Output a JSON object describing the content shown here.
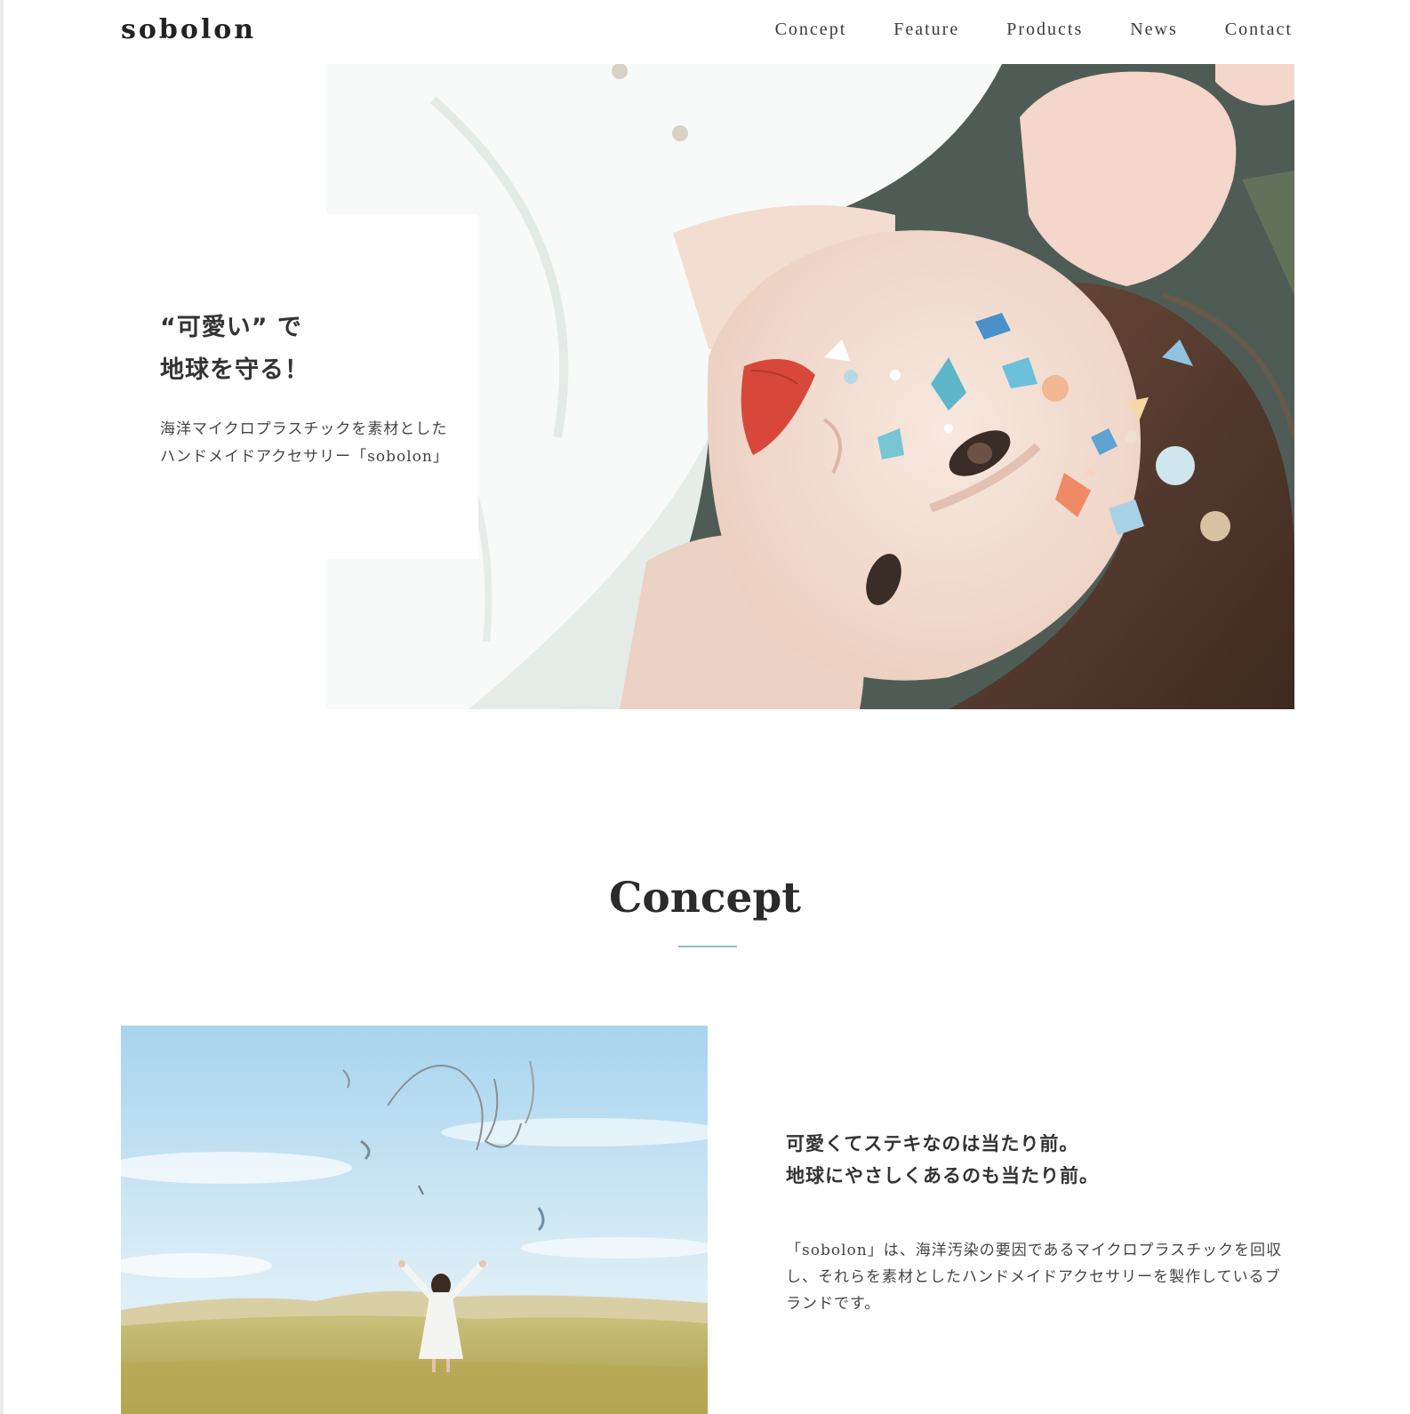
{
  "header": {
    "logo": "sobolon",
    "nav": [
      "Concept",
      "Feature",
      "Products",
      "News",
      "Contact"
    ]
  },
  "hero": {
    "heading_lines": [
      "“可愛い” で",
      "地球を守る！"
    ],
    "sub_lines": [
      "海洋マイクロプラスチックを素材とした",
      "ハンドメイドアクセサリー「sobolon」"
    ]
  },
  "concept": {
    "title": "Concept",
    "heading_lines": [
      "可愛くてステキなのは当たり前。",
      "地球にやさしくあるのも当たり前。"
    ],
    "body": "「sobolon」は、海洋汚染の要因であるマイクロプラスチックを回収し、それらを素材としたハンドメイドアクセサリーを製作しているブランドです。"
  },
  "colors": {
    "accent_divider": "#8db7d6",
    "text": "#333333",
    "background": "#ffffff"
  }
}
